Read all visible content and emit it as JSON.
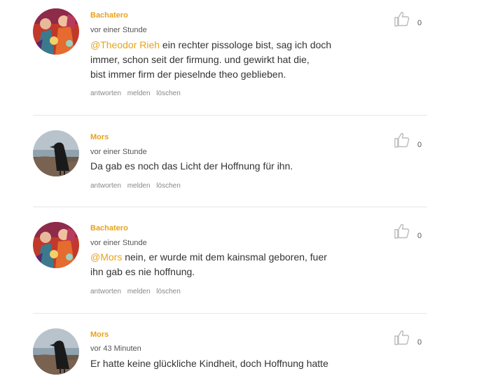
{
  "comments": [
    {
      "author": "Bachatero",
      "avatar_icon": "painted-figures-avatar",
      "time": "vor einer Stunde",
      "mention": "@Theodor Rieh",
      "line1": " ein rechter pissologe bist, sag ich doch",
      "line2": "immer, schon seit der firmung. und gewirkt hat die,",
      "line3": "bist immer firm der pieselnde theo geblieben.",
      "actions": {
        "reply": "antworten",
        "report": "melden",
        "delete": "löschen"
      },
      "likes": "0"
    },
    {
      "author": "Mors",
      "avatar_icon": "raven-avatar",
      "time": "vor einer Stunde",
      "line1": "Da gab es noch das Licht der Hoffnung für ihn.",
      "actions": {
        "reply": "antworten",
        "report": "melden",
        "delete": "löschen"
      },
      "likes": "0"
    },
    {
      "author": "Bachatero",
      "avatar_icon": "painted-figures-avatar",
      "time": "vor einer Stunde",
      "mention": "@Mors",
      "line1": " nein, er wurde mit dem kainsmal geboren, fuer",
      "line2": "ihn gab es nie hoffnung.",
      "actions": {
        "reply": "antworten",
        "report": "melden",
        "delete": "löschen"
      },
      "likes": "0"
    },
    {
      "author": "Mors",
      "avatar_icon": "raven-avatar",
      "time": "vor 43 Minuten",
      "line1": "Er hatte keine glückliche Kindheit, doch Hoffnung hatte",
      "likes": "0"
    }
  ],
  "colors": {
    "author": "#e8a21a",
    "mention": "#e8a21a",
    "text": "#333333",
    "meta": "#888888",
    "divider": "#e6e6e6"
  }
}
